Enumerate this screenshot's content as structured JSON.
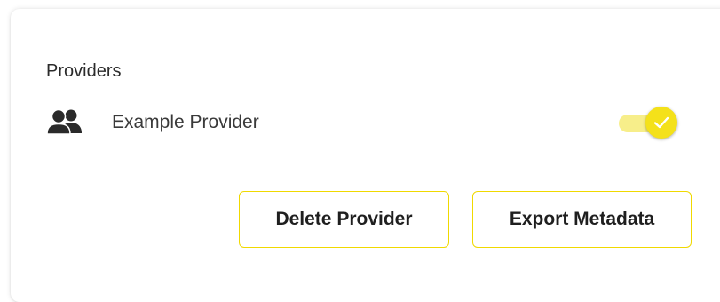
{
  "section": {
    "title": "Providers"
  },
  "provider": {
    "name": "Example Provider",
    "icon": "people-icon",
    "enabled": true
  },
  "actions": {
    "delete_label": "Delete Provider",
    "export_label": "Export Metadata"
  },
  "colors": {
    "accent": "#f4e11a",
    "toggle_track": "#f7ee8a",
    "button_border": "#f0d900"
  }
}
